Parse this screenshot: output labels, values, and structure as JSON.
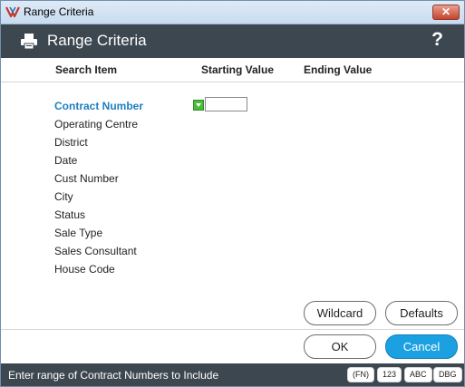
{
  "window": {
    "title": "Range Criteria",
    "close_label": "✕"
  },
  "header": {
    "title": "Range Criteria",
    "help_label": "?"
  },
  "columns": {
    "search_item": "Search Item",
    "starting_value": "Starting Value",
    "ending_value": "Ending Value"
  },
  "items": [
    {
      "label": "Contract Number",
      "active": true
    },
    {
      "label": "Operating Centre",
      "active": false
    },
    {
      "label": "District",
      "active": false
    },
    {
      "label": "Date",
      "active": false
    },
    {
      "label": "Cust Number",
      "active": false
    },
    {
      "label": "City",
      "active": false
    },
    {
      "label": "Status",
      "active": false
    },
    {
      "label": "Sale Type",
      "active": false
    },
    {
      "label": "Sales Consultant",
      "active": false
    },
    {
      "label": "House Code",
      "active": false
    }
  ],
  "inputs": {
    "starting_value": ""
  },
  "buttons": {
    "wildcard": "Wildcard",
    "defaults": "Defaults",
    "ok": "OK",
    "cancel": "Cancel"
  },
  "status": {
    "message": "Enter range of Contract Numbers to Include",
    "tags": [
      "(FN)",
      "123",
      "ABC",
      "DBG"
    ]
  },
  "colors": {
    "active_item": "#1f7ec2",
    "header_bg": "#3c4750",
    "cancel_bg": "#1ba1e2",
    "indicator": "#4cbb3b"
  }
}
